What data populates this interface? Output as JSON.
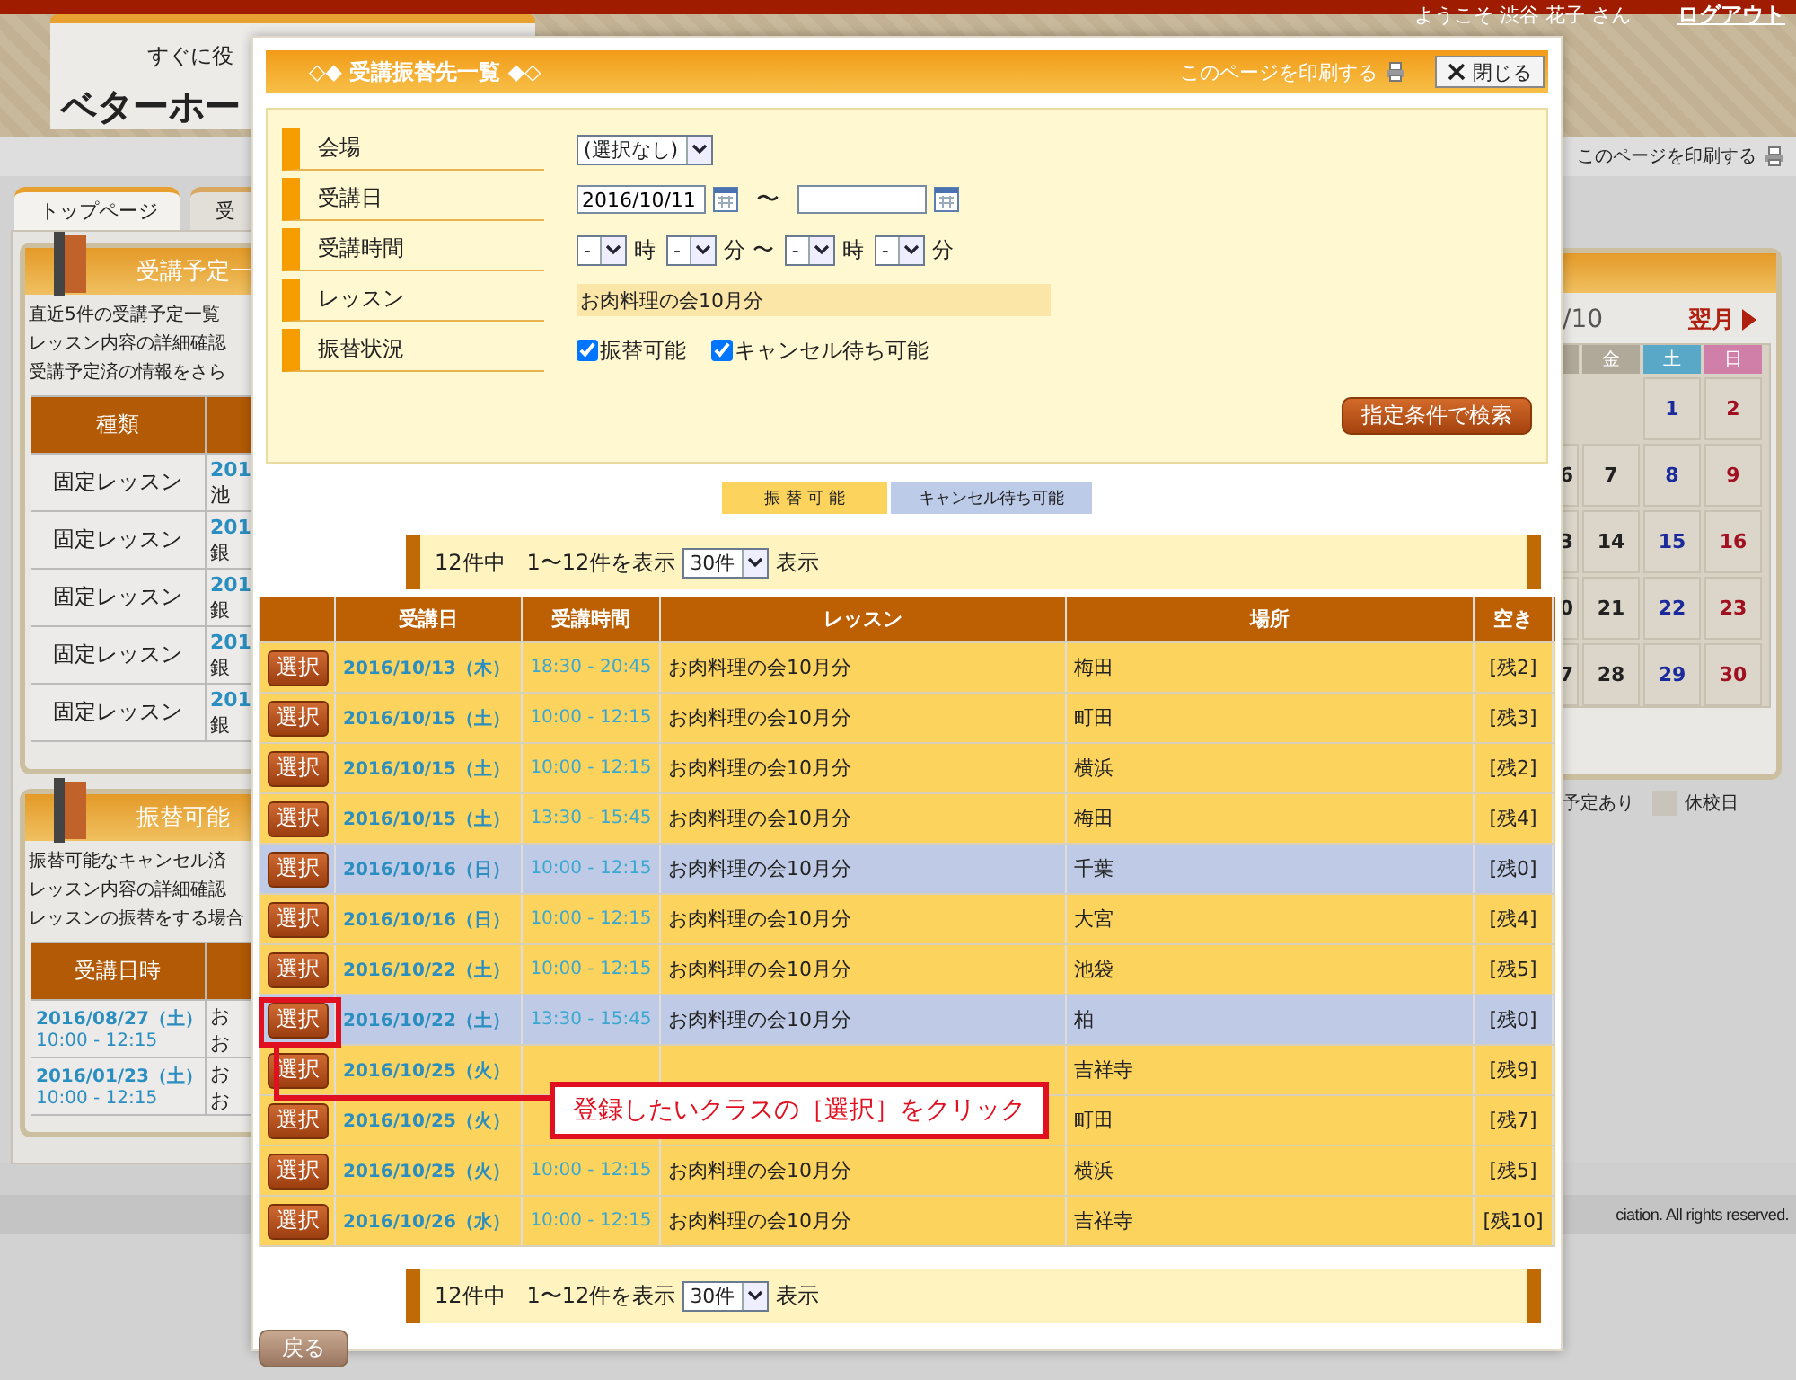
{
  "top_bar": {
    "welcome": "ようこそ 渋谷 花子 さん",
    "logout": "ログアウト"
  },
  "logo": {
    "tagline": "すぐに役",
    "name": "ベターホー"
  },
  "page_print": "このページを印刷する",
  "tabs": [
    {
      "label": "トップページ",
      "selected": true
    },
    {
      "label": "受",
      "selected": false
    }
  ],
  "schedule_panel": {
    "title": "受講予定一",
    "lines": [
      "直近5件の受講予定一覧",
      "レッスン内容の詳細確認",
      "受講予定済の情報をさら"
    ],
    "column": "種類",
    "rows": [
      {
        "type": "固定レッスン",
        "date": "201",
        "place": "池"
      },
      {
        "type": "固定レッスン",
        "date": "201",
        "place": "銀"
      },
      {
        "type": "固定レッスン",
        "date": "201",
        "place": "銀"
      },
      {
        "type": "固定レッスン",
        "date": "201",
        "place": "銀"
      },
      {
        "type": "固定レッスン",
        "date": "201",
        "place": "銀"
      }
    ]
  },
  "transfer_panel": {
    "title": "振替可能",
    "lines": [
      "振替可能なキャンセル済",
      "レッスン内容の詳細確認",
      "レッスンの振替をする場合"
    ],
    "column": "受講日時",
    "rows": [
      {
        "date": "2016/08/27（土）",
        "time": "10:00 - 12:15",
        "column_2": [
          "お",
          "お"
        ]
      },
      {
        "date": "2016/01/23（土）",
        "time": "10:00 - 12:15",
        "column_2": [
          "お",
          "お"
        ]
      }
    ]
  },
  "calendar": {
    "month": "/10",
    "next": "翌月",
    "weekdays": {
      "fri": "金",
      "sat": "土",
      "sun": "日"
    },
    "weeks": [
      {
        "sat": "1",
        "sun": "2"
      },
      {
        "cut": "6",
        "fri": "7",
        "sat": "8",
        "sun": "9"
      },
      {
        "cut": "3",
        "fri": "14",
        "sat": "15",
        "sun": "16"
      },
      {
        "cut": "0",
        "fri": "21",
        "sat": "22",
        "sun": "23"
      },
      {
        "cut": "7",
        "fri": "28",
        "sat": "29",
        "sun": "30"
      }
    ],
    "legend": [
      {
        "label": "予定あり",
        "kind": "text"
      },
      {
        "label": "休校日",
        "kind": "holiday"
      }
    ]
  },
  "footer": "ciation. All rights reserved.",
  "modal": {
    "title": "◇◆ 受講振替先一覧 ◆◇",
    "print": "このページを印刷する",
    "close": "閉じる",
    "form": [
      {
        "label": "会場",
        "kind": "select",
        "value": "(選択なし)"
      },
      {
        "label": "受講日",
        "kind": "date_range",
        "from": "2016/10/11",
        "separator": "〜"
      },
      {
        "label": "受講時間",
        "kind": "time_range",
        "parts": [
          {
            "kind": "select",
            "value": "-"
          },
          {
            "kind": "text",
            "value": "時"
          },
          {
            "kind": "select",
            "value": "-"
          },
          {
            "kind": "text",
            "value": "分 〜"
          },
          {
            "kind": "select",
            "value": "-"
          },
          {
            "kind": "text",
            "value": "時"
          },
          {
            "kind": "select",
            "value": "-"
          },
          {
            "kind": "text",
            "value": "分"
          }
        ]
      },
      {
        "label": "レッスン",
        "kind": "readonly",
        "value": "お肉料理の会10月分"
      },
      {
        "label": "振替状況",
        "kind": "checkboxes",
        "options": [
          {
            "label": "振替可能",
            "checked": true
          },
          {
            "label": "キャンセル待ち可能",
            "checked": true
          }
        ]
      }
    ],
    "search_button": "指定条件で検索",
    "legend": [
      {
        "label": "振 替 可 能",
        "kind": "available"
      },
      {
        "label": "キャンセル待ち可能",
        "kind": "waitlist"
      }
    ],
    "pagers": [
      {
        "summary": "12件中　1〜12件を表示",
        "per_page": "30件",
        "suffix": "表示"
      },
      {
        "summary": "12件中　1〜12件を表示",
        "per_page": "30件",
        "suffix": "表示"
      }
    ],
    "columns": [
      "受講日",
      "受講時間",
      "レッスン",
      "場所",
      "空き"
    ],
    "rows": [
      {
        "kind": "available",
        "button": "選択",
        "date": "2016/10/13（木）",
        "time": "18:30 - 20:45",
        "lesson": "お肉料理の会10月分",
        "place": "梅田",
        "vacancy": "[残2]",
        "highlighted": false
      },
      {
        "kind": "available",
        "button": "選択",
        "date": "2016/10/15（土）",
        "time": "10:00 - 12:15",
        "lesson": "お肉料理の会10月分",
        "place": "町田",
        "vacancy": "[残3]",
        "highlighted": false
      },
      {
        "kind": "available",
        "button": "選択",
        "date": "2016/10/15（土）",
        "time": "10:00 - 12:15",
        "lesson": "お肉料理の会10月分",
        "place": "横浜",
        "vacancy": "[残2]",
        "highlighted": false
      },
      {
        "kind": "available",
        "button": "選択",
        "date": "2016/10/15（土）",
        "time": "13:30 - 15:45",
        "lesson": "お肉料理の会10月分",
        "place": "梅田",
        "vacancy": "[残4]",
        "highlighted": false
      },
      {
        "kind": "waitlist",
        "button": "選択",
        "date": "2016/10/16（日）",
        "time": "10:00 - 12:15",
        "lesson": "お肉料理の会10月分",
        "place": "千葉",
        "vacancy": "[残0]",
        "highlighted": false
      },
      {
        "kind": "available",
        "button": "選択",
        "date": "2016/10/16（日）",
        "time": "10:00 - 12:15",
        "lesson": "お肉料理の会10月分",
        "place": "大宮",
        "vacancy": "[残4]",
        "highlighted": false
      },
      {
        "kind": "available",
        "button": "選択",
        "date": "2016/10/22（土）",
        "time": "10:00 - 12:15",
        "lesson": "お肉料理の会10月分",
        "place": "池袋",
        "vacancy": "[残5]",
        "highlighted": false
      },
      {
        "kind": "waitlist",
        "button": "選択",
        "date": "2016/10/22（土）",
        "time": "13:30 - 15:45",
        "lesson": "お肉料理の会10月分",
        "place": "柏",
        "vacancy": "[残0]",
        "highlighted": true
      },
      {
        "kind": "available",
        "button": "選択",
        "date": "2016/10/25（火）",
        "place": "吉祥寺",
        "vacancy": "[残9]",
        "highlighted": false
      },
      {
        "kind": "available",
        "button": "選択",
        "date": "2016/10/25（火）",
        "place": "町田",
        "vacancy": "[残7]",
        "highlighted": false
      },
      {
        "kind": "available",
        "button": "選択",
        "date": "2016/10/25（火）",
        "time": "10:00 - 12:15",
        "lesson": "お肉料理の会10月分",
        "place": "横浜",
        "vacancy": "[残5]",
        "highlighted": false
      },
      {
        "kind": "available",
        "button": "選択",
        "date": "2016/10/26（水）",
        "time": "10:00 - 12:15",
        "lesson": "お肉料理の会10月分",
        "place": "吉祥寺",
        "vacancy": "[残10]",
        "highlighted": false
      }
    ],
    "back": "戻る",
    "callout": "登録したいクラスの［選択］をクリック"
  }
}
